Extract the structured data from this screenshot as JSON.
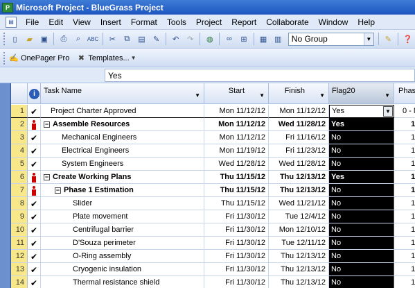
{
  "window": {
    "title": "Microsoft Project - BlueGrass Project"
  },
  "menu": [
    "File",
    "Edit",
    "View",
    "Insert",
    "Format",
    "Tools",
    "Project",
    "Report",
    "Collaborate",
    "Window",
    "Help"
  ],
  "toolbar": {
    "group_value": "No Group"
  },
  "toolbar2": {
    "onepager_label": "OnePager Pro",
    "templates_label": "Templates..."
  },
  "entry_bar": {
    "value": "Yes"
  },
  "columns": {
    "task_name": "Task Name",
    "start": "Start",
    "finish": "Finish",
    "flag": "Flag20",
    "phase": "Phas"
  },
  "rows": [
    {
      "id": "1",
      "indicator": "check",
      "name": "Project Charter Approved",
      "start": "Mon 11/12/12",
      "finish": "Mon 11/12/12",
      "flag": "Yes",
      "phase": "0 - M",
      "bold": false,
      "summary": "none"
    },
    {
      "id": "2",
      "indicator": "person",
      "name": "Assemble Resources",
      "start": "Mon 11/12/12",
      "finish": "Wed 11/28/12",
      "flag": "Yes",
      "phase": "1 -",
      "bold": true,
      "summary": "top"
    },
    {
      "id": "3",
      "indicator": "check",
      "name": "Mechanical Engineers",
      "start": "Mon 11/12/12",
      "finish": "Fri 11/16/12",
      "flag": "No",
      "phase": "1 -",
      "bold": false,
      "summary": "child"
    },
    {
      "id": "4",
      "indicator": "check",
      "name": "Electrical Engineers",
      "start": "Mon 11/19/12",
      "finish": "Fri 11/23/12",
      "flag": "No",
      "phase": "1 -",
      "bold": false,
      "summary": "child"
    },
    {
      "id": "5",
      "indicator": "check",
      "name": "System Engineers",
      "start": "Wed 11/28/12",
      "finish": "Wed 11/28/12",
      "flag": "No",
      "phase": "1 -",
      "bold": false,
      "summary": "child"
    },
    {
      "id": "6",
      "indicator": "person",
      "name": "Create Working Plans",
      "start": "Thu 11/15/12",
      "finish": "Thu 12/13/12",
      "flag": "Yes",
      "phase": "1 -",
      "bold": true,
      "summary": "top"
    },
    {
      "id": "7",
      "indicator": "person",
      "name": "Phase 1 Estimation",
      "start": "Thu 11/15/12",
      "finish": "Thu 12/13/12",
      "flag": "No",
      "phase": "1 -",
      "bold": true,
      "summary": "sub"
    },
    {
      "id": "8",
      "indicator": "check",
      "name": "Slider",
      "start": "Thu 11/15/12",
      "finish": "Wed 11/21/12",
      "flag": "No",
      "phase": "1 -",
      "bold": false,
      "summary": "grandchild"
    },
    {
      "id": "9",
      "indicator": "check",
      "name": "Plate movement",
      "start": "Fri 11/30/12",
      "finish": "Tue 12/4/12",
      "flag": "No",
      "phase": "1 -",
      "bold": false,
      "summary": "grandchild"
    },
    {
      "id": "10",
      "indicator": "check",
      "name": "Centrifugal barrier",
      "start": "Fri 11/30/12",
      "finish": "Mon 12/10/12",
      "flag": "No",
      "phase": "1 -",
      "bold": false,
      "summary": "grandchild"
    },
    {
      "id": "11",
      "indicator": "check",
      "name": "D'Souza perimeter",
      "start": "Fri 11/30/12",
      "finish": "Tue 12/11/12",
      "flag": "No",
      "phase": "1 -",
      "bold": false,
      "summary": "grandchild"
    },
    {
      "id": "12",
      "indicator": "check",
      "name": "O-Ring assembly",
      "start": "Fri 11/30/12",
      "finish": "Thu 12/13/12",
      "flag": "No",
      "phase": "1 -",
      "bold": false,
      "summary": "grandchild"
    },
    {
      "id": "13",
      "indicator": "check",
      "name": "Cryogenic insulation",
      "start": "Fri 11/30/12",
      "finish": "Thu 12/13/12",
      "flag": "No",
      "phase": "1 -",
      "bold": false,
      "summary": "grandchild"
    },
    {
      "id": "14",
      "indicator": "check",
      "name": "Thermal resistance shield",
      "start": "Fri 11/30/12",
      "finish": "Thu 12/13/12",
      "flag": "No",
      "phase": "1 -",
      "bold": false,
      "summary": "grandchild"
    }
  ]
}
